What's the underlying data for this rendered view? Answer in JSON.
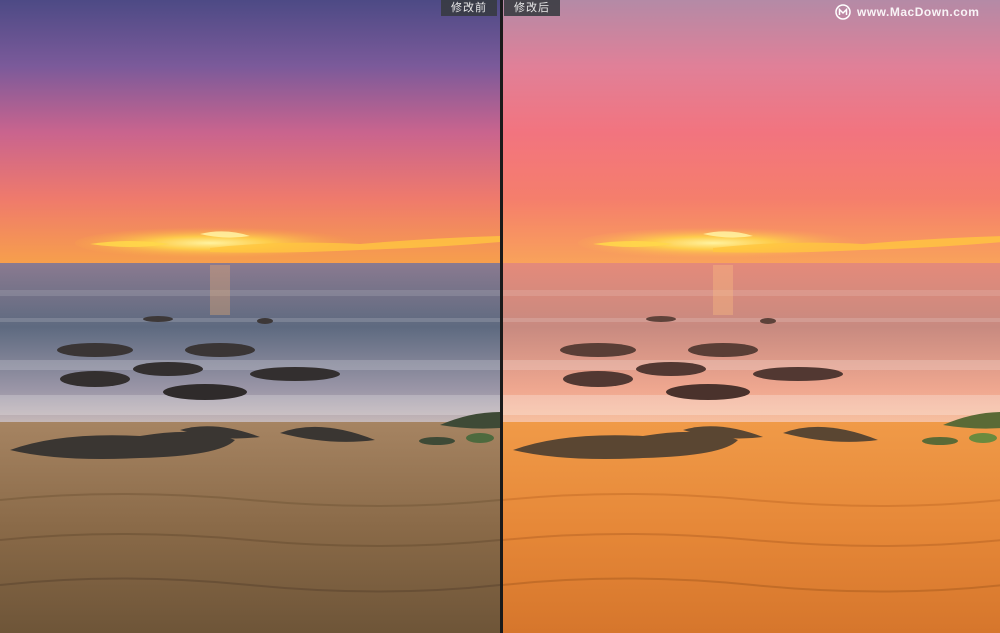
{
  "labels": {
    "before": "修改前",
    "after": "修改后"
  },
  "watermark": {
    "text": "www.MacDown.com",
    "icon": "macdown-logo-icon"
  },
  "colors": {
    "before_sky_top": "#5a4e8a",
    "before_sky_mid": "#e86a8a",
    "before_horizon": "#f6a14a",
    "before_sand": "#8f6e4a",
    "after_sky_top": "#b88aa8",
    "after_sky_mid": "#f07a8a",
    "after_horizon": "#f9a35a",
    "after_sand": "#e8893a"
  }
}
